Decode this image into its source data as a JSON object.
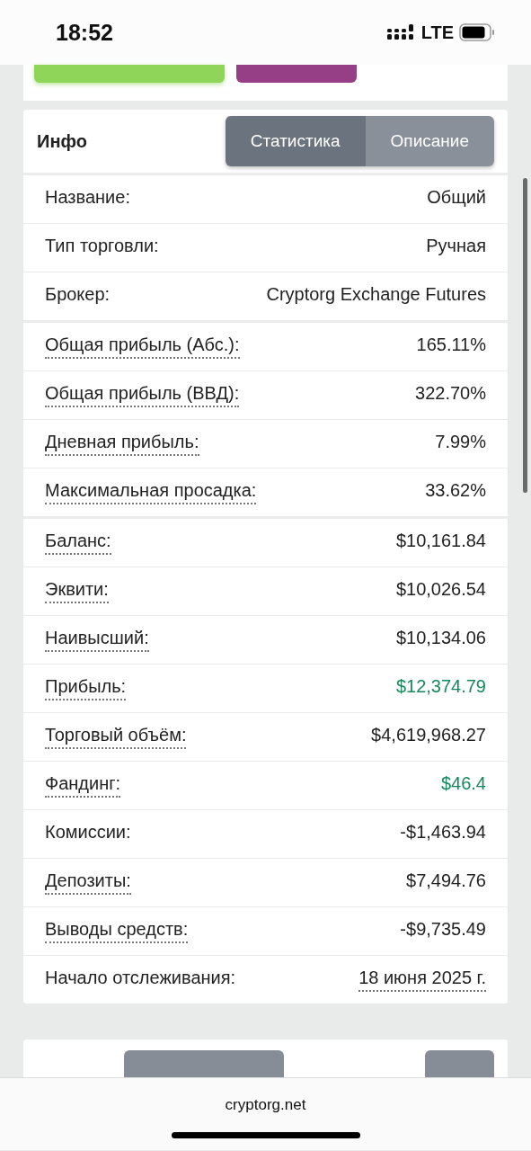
{
  "status_bar": {
    "time": "18:52",
    "network": "LTE"
  },
  "top_buttons": [
    {
      "color": "#8fd55a"
    },
    {
      "color": "#963f87"
    }
  ],
  "info": {
    "title": "Инфо",
    "tabs": [
      {
        "label": "Статистика",
        "selected": true
      },
      {
        "label": "Описание",
        "selected": false
      }
    ],
    "groups": [
      [
        {
          "label": "Название:",
          "value": "Общий",
          "label_hint": false,
          "value_hint": false,
          "positive": false
        },
        {
          "label": "Тип торговли:",
          "value": "Ручная",
          "label_hint": false,
          "value_hint": false,
          "positive": false
        },
        {
          "label": "Брокер:",
          "value": "Cryptorg Exchange Futures",
          "label_hint": false,
          "value_hint": false,
          "positive": false
        }
      ],
      [
        {
          "label": "Общая прибыль (Абс.):",
          "value": "165.11%",
          "label_hint": true,
          "value_hint": false,
          "positive": false
        },
        {
          "label": "Общая прибыль (ВВД):",
          "value": "322.70%",
          "label_hint": true,
          "value_hint": false,
          "positive": false
        },
        {
          "label": "Дневная прибыль:",
          "value": "7.99%",
          "label_hint": true,
          "value_hint": false,
          "positive": false
        },
        {
          "label": "Максимальная просадка:",
          "value": "33.62%",
          "label_hint": true,
          "value_hint": false,
          "positive": false
        }
      ],
      [
        {
          "label": "Баланс:",
          "value": "$10,161.84",
          "label_hint": true,
          "value_hint": false,
          "positive": false
        },
        {
          "label": "Эквити:",
          "value": "$10,026.54",
          "label_hint": true,
          "value_hint": false,
          "positive": false
        },
        {
          "label": "Наивысший:",
          "value": "$10,134.06",
          "label_hint": true,
          "value_hint": false,
          "positive": false
        },
        {
          "label": "Прибыль:",
          "value": "$12,374.79",
          "label_hint": true,
          "value_hint": false,
          "positive": true
        },
        {
          "label": "Торговый объём:",
          "value": "$4,619,968.27",
          "label_hint": true,
          "value_hint": false,
          "positive": false
        },
        {
          "label": "Фандинг:",
          "value": "$46.4",
          "label_hint": true,
          "value_hint": false,
          "positive": true
        },
        {
          "label": "Комиссии:",
          "value": "-$1,463.94",
          "label_hint": false,
          "value_hint": false,
          "positive": false
        },
        {
          "label": "Депозиты:",
          "value": "$7,494.76",
          "label_hint": true,
          "value_hint": false,
          "positive": false
        },
        {
          "label": "Выводы средств:",
          "value": "-$9,735.49",
          "label_hint": true,
          "value_hint": false,
          "positive": false
        },
        {
          "label": "Начало отслеживания:",
          "value": "18 июня 2025 г.",
          "label_hint": false,
          "value_hint": true,
          "positive": false
        }
      ]
    ]
  },
  "browser_bar": {
    "url": "cryptorg.net"
  }
}
